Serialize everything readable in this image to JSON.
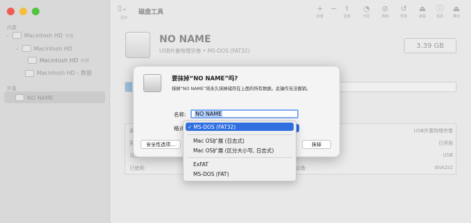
{
  "sidebar": {
    "section_internal": "内置",
    "section_external": "外置",
    "items": [
      {
        "label": "Macintosh HD",
        "sub": "宗卷"
      },
      {
        "label": "Macintosh HD",
        "sub": ""
      },
      {
        "label": "Macintosh HD",
        "sub": "快照"
      },
      {
        "label": "Macintosh HD - 数据",
        "sub": ""
      },
      {
        "label": "NO NAME",
        "sub": ""
      }
    ]
  },
  "toolbar": {
    "view_label": "显示",
    "title": "磁盘工具",
    "buttons": [
      {
        "icon": "add-icon",
        "glyph": "+",
        "label": "宗卷"
      },
      {
        "icon": "remove-icon",
        "glyph": "−",
        "label": ""
      },
      {
        "icon": "first-aid-icon",
        "glyph": "⚕",
        "label": "急救"
      },
      {
        "icon": "partition-icon",
        "glyph": "◔",
        "label": "分区"
      },
      {
        "icon": "erase-icon",
        "glyph": "⊘",
        "label": "抹掉"
      },
      {
        "icon": "restore-icon",
        "glyph": "↺",
        "label": "恢复"
      },
      {
        "icon": "mount-icon",
        "glyph": "⏏",
        "label": "装载"
      },
      {
        "icon": "info-icon",
        "glyph": "ⓘ",
        "label": "信息"
      },
      {
        "icon": "eject-icon",
        "glyph": "⏏",
        "label": "推出"
      }
    ]
  },
  "volume": {
    "name": "NO NAME",
    "subtitle": "USB外置物理宗卷 • MS-DOS (FAT32)",
    "size": "3.39 GB",
    "usage_fraction": 0.02
  },
  "info": {
    "rows": [
      {
        "key": "装载点:",
        "key2": "",
        "value": "USB外置物理宗卷"
      },
      {
        "key": "容量:",
        "key2": "",
        "value": "已停用"
      },
      {
        "key": "可用:",
        "key2": "",
        "value": "USB"
      },
      {
        "key": "已使用:",
        "key2": "设备:",
        "value": "disk2s1"
      }
    ]
  },
  "dialog": {
    "title": "要抹掉“NO NAME”吗?",
    "message": "抹掉“NO NAME”将永久抹掉储存在上面的所有数据。此操作无法撤销。",
    "name_label": "名称:",
    "name_value": "NO NAME",
    "format_label": "格式",
    "security_button": "安全性选项...",
    "erase_button": "抹掉"
  },
  "format_menu": {
    "items": [
      {
        "label": "MS-DOS (FAT32)",
        "selected": true
      },
      {
        "label": "Mac OS扩展 (日志式)",
        "selected": false
      },
      {
        "label": "Mac OS扩展 (区分大小写, 日志式)",
        "selected": false
      },
      {
        "label": "ExFAT",
        "selected": false
      },
      {
        "label": "MS-DOS (FAT)",
        "selected": false
      }
    ],
    "check_glyph": "✓"
  }
}
